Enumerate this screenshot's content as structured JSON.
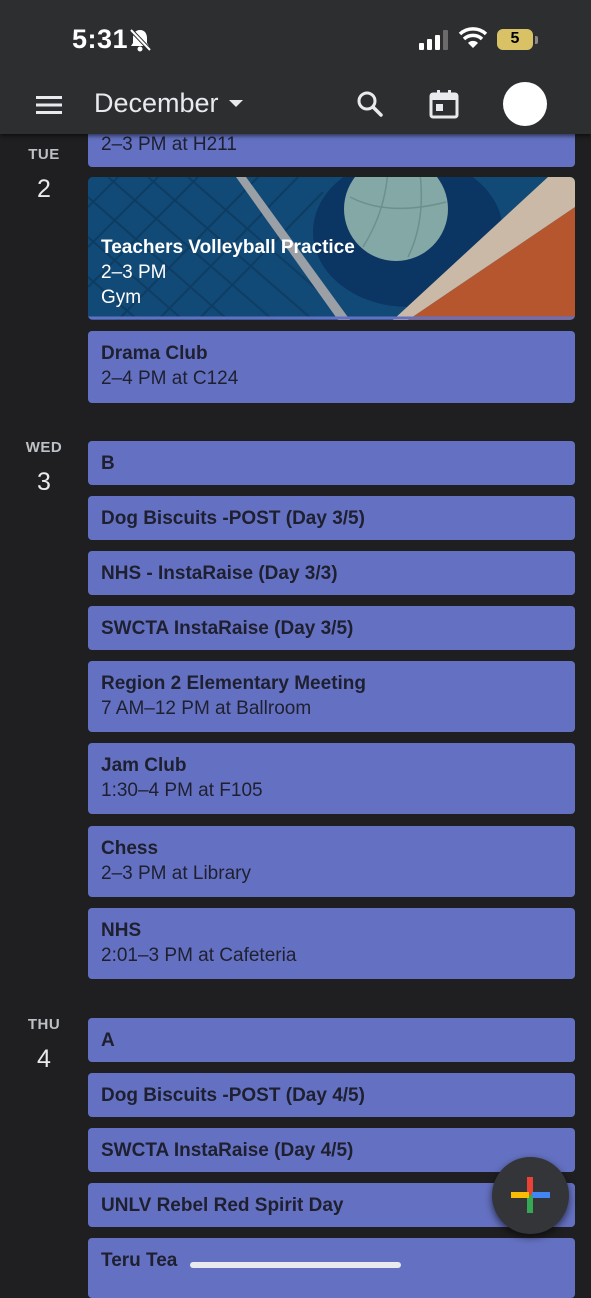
{
  "status_bar": {
    "time": "5:31",
    "battery": "5"
  },
  "header": {
    "month": "December"
  },
  "icons": {
    "menu": "hamburger-menu-icon",
    "search": "search-icon",
    "today": "calendar-today-icon",
    "add": "plus-icon"
  },
  "colors": {
    "background": "#1f1f21",
    "event": "#6471c2",
    "appbar": "#2d2e30",
    "battery": "#d9c266"
  },
  "partial_event": {
    "sub": "2–3 PM at H211"
  },
  "days": [
    {
      "dow": "TUE",
      "num": "2",
      "events": [
        {
          "title": "Teachers Volleyball Practice",
          "time": "2–3 PM",
          "location": "Gym"
        },
        {
          "title": "Drama Club",
          "sub": "2–4 PM at C124"
        }
      ]
    },
    {
      "dow": "WED",
      "num": "3",
      "events": [
        {
          "title": "B"
        },
        {
          "title": "Dog Biscuits -POST (Day 3/5)"
        },
        {
          "title": "NHS - InstaRaise (Day 3/3)"
        },
        {
          "title": "SWCTA InstaRaise (Day 3/5)"
        },
        {
          "title": "Region 2 Elementary Meeting",
          "sub": "7 AM–12 PM at Ballroom"
        },
        {
          "title": "Jam Club",
          "sub": "1:30–4 PM at F105"
        },
        {
          "title": "Chess",
          "sub": "2–3 PM at Library"
        },
        {
          "title": "NHS",
          "sub": "2:01–3 PM at Cafeteria"
        }
      ]
    },
    {
      "dow": "THU",
      "num": "4",
      "events": [
        {
          "title": "A"
        },
        {
          "title": "Dog Biscuits -POST (Day 4/5)"
        },
        {
          "title": "SWCTA InstaRaise (Day 4/5)"
        },
        {
          "title": "UNLV Rebel Red Spirit Day"
        },
        {
          "title": "Teru Tea"
        }
      ]
    }
  ]
}
